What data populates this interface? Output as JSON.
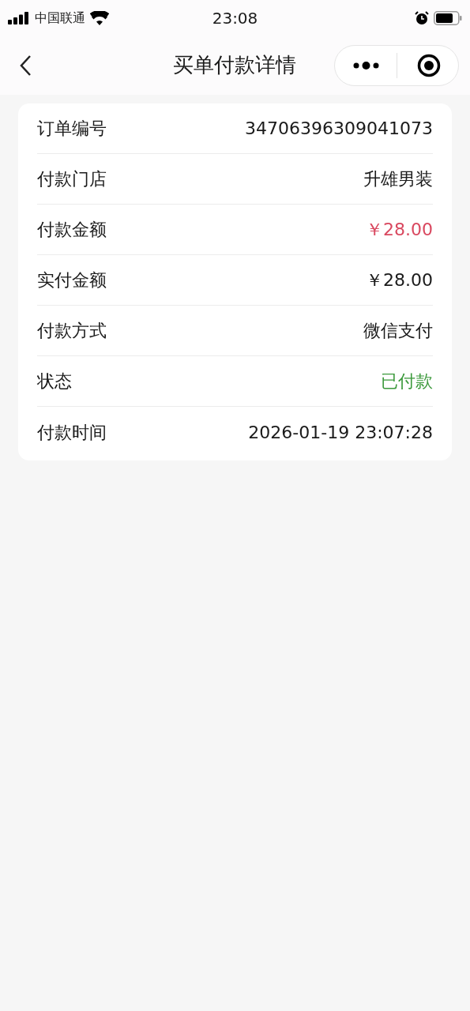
{
  "status_bar": {
    "carrier": "中国联通",
    "time": "23:08"
  },
  "nav": {
    "title": "买单付款详情"
  },
  "rows": [
    {
      "label": "订单编号",
      "value": "34706396309041073",
      "color": "#1a1a1a"
    },
    {
      "label": "付款门店",
      "value": "升雄男装",
      "color": "#1a1a1a"
    },
    {
      "label": "付款金额",
      "value": "￥28.00",
      "color": "#d9485f"
    },
    {
      "label": "实付金额",
      "value": "￥28.00",
      "color": "#1a1a1a"
    },
    {
      "label": "付款方式",
      "value": "微信支付",
      "color": "#1a1a1a"
    },
    {
      "label": "状态",
      "value": "已付款",
      "color": "#3d9a3d"
    },
    {
      "label": "付款时间",
      "value": "2026-01-19 23:07:28",
      "color": "#1a1a1a"
    }
  ]
}
